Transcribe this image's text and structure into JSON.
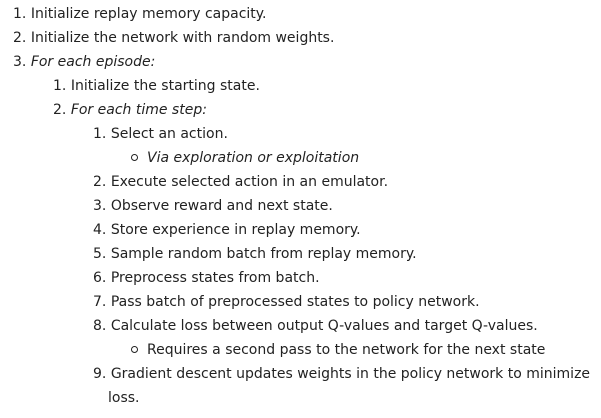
{
  "steps": [
    {
      "num": "1.",
      "text": "Initialize replay memory capacity."
    },
    {
      "num": "2.",
      "text": "Initialize the network with random weights."
    },
    {
      "num": "3.",
      "text": "For each episode:"
    }
  ],
  "episode_steps": [
    {
      "num": "1.",
      "text": "Initialize the starting state."
    },
    {
      "num": "2.",
      "text": "For each time step:"
    }
  ],
  "time_steps": [
    {
      "num": "1.",
      "text": "Select an action."
    },
    {
      "num": "2.",
      "text": "Execute selected action in an emulator."
    },
    {
      "num": "3.",
      "text": "Observe reward and next state."
    },
    {
      "num": "4.",
      "text": "Store experience in replay memory."
    },
    {
      "num": "5.",
      "text": "Sample random batch from replay memory."
    },
    {
      "num": "6.",
      "text": "Preprocess states from batch."
    },
    {
      "num": "7.",
      "text": "Pass batch of preprocessed states to policy network."
    },
    {
      "num": "8.",
      "text": "Calculate loss between output Q-values and target Q-values."
    },
    {
      "num": "9.",
      "text": "Gradient descent updates weights in the policy network to minimize",
      "continuation": "loss."
    }
  ],
  "notes": {
    "select_action": "Via exploration or exploitation",
    "calculate_loss": "Requires a second pass to the network for the next state"
  }
}
